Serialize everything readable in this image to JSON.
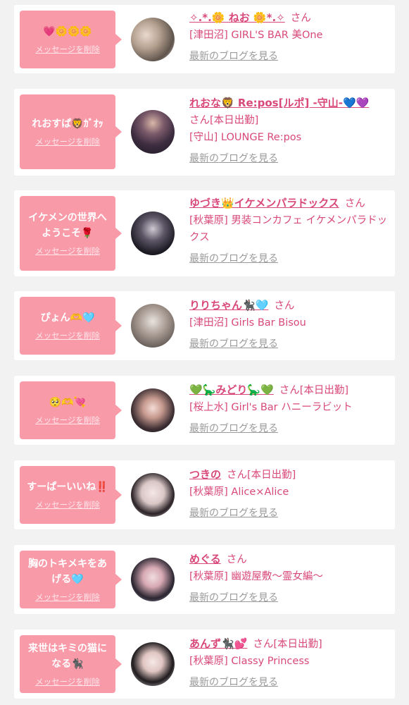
{
  "delete_label": "メッセージを削除",
  "blog_label": "最新のブログを見る",
  "san_label": "さん",
  "colors": {
    "bubble": "#f99aa9",
    "accent": "#d8487a",
    "link_gray": "#9a9a9a"
  },
  "cards": [
    {
      "message": "💗🌼🌼🌼",
      "name": "✧.*.🌼 ねお 🌼*.✧",
      "status": "",
      "shop": "[津田沼] GIRL'S BAR 美One"
    },
    {
      "message": "れおすぱ🦁ｶﾞｵｯ",
      "name": "れおな🦁 Re:pos[ルポ] -守山-💙💜",
      "status": "[本日出勤]",
      "shop": "[守山] LOUNGE Re:pos"
    },
    {
      "message": "イケメンの世界へようこそ🌹",
      "name": "ゆづき👑イケメンパラドックス",
      "status": "",
      "shop": "[秋葉原] 男装コンカフェ イケメンパラドックス"
    },
    {
      "message": "ぴょん🫶🩵",
      "name": "りりちゃん🐈‍⬛🩵",
      "status": "",
      "shop": "[津田沼] Girls Bar Bisou"
    },
    {
      "message": "🥺🫶💘",
      "name": "💚🦕みどり🦕💚",
      "status": "[本日出勤]",
      "shop": "[桜上水] Girl's Bar ハニーラビット"
    },
    {
      "message": "すーぱーいいね‼️",
      "name": "つきの",
      "status": "[本日出勤]",
      "shop": "[秋葉原] Alice×Alice"
    },
    {
      "message": "胸のトキメキをあげる🩵",
      "name": "めぐる",
      "status": "",
      "shop": "[秋葉原] 幽遊屋敷〜霊女編〜"
    },
    {
      "message": "来世はキミの猫になる🐈‍⬛",
      "name": "あんず🐈‍⬛💕",
      "status": "[本日出勤]",
      "shop": "[秋葉原] Classy Princess"
    }
  ]
}
